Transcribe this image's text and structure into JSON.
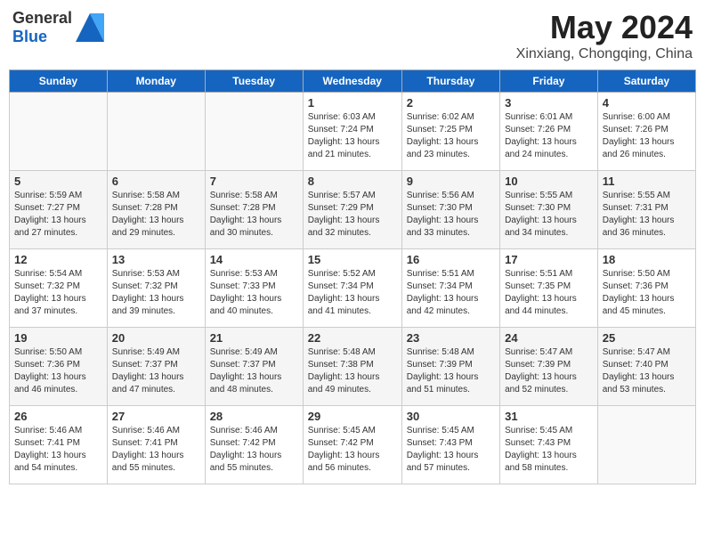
{
  "header": {
    "logo_general": "General",
    "logo_blue": "Blue",
    "title": "May 2024",
    "location": "Xinxiang, Chongqing, China"
  },
  "weekdays": [
    "Sunday",
    "Monday",
    "Tuesday",
    "Wednesday",
    "Thursday",
    "Friday",
    "Saturday"
  ],
  "weeks": [
    [
      {
        "day": "",
        "info": ""
      },
      {
        "day": "",
        "info": ""
      },
      {
        "day": "",
        "info": ""
      },
      {
        "day": "1",
        "info": "Sunrise: 6:03 AM\nSunset: 7:24 PM\nDaylight: 13 hours\nand 21 minutes."
      },
      {
        "day": "2",
        "info": "Sunrise: 6:02 AM\nSunset: 7:25 PM\nDaylight: 13 hours\nand 23 minutes."
      },
      {
        "day": "3",
        "info": "Sunrise: 6:01 AM\nSunset: 7:26 PM\nDaylight: 13 hours\nand 24 minutes."
      },
      {
        "day": "4",
        "info": "Sunrise: 6:00 AM\nSunset: 7:26 PM\nDaylight: 13 hours\nand 26 minutes."
      }
    ],
    [
      {
        "day": "5",
        "info": "Sunrise: 5:59 AM\nSunset: 7:27 PM\nDaylight: 13 hours\nand 27 minutes."
      },
      {
        "day": "6",
        "info": "Sunrise: 5:58 AM\nSunset: 7:28 PM\nDaylight: 13 hours\nand 29 minutes."
      },
      {
        "day": "7",
        "info": "Sunrise: 5:58 AM\nSunset: 7:28 PM\nDaylight: 13 hours\nand 30 minutes."
      },
      {
        "day": "8",
        "info": "Sunrise: 5:57 AM\nSunset: 7:29 PM\nDaylight: 13 hours\nand 32 minutes."
      },
      {
        "day": "9",
        "info": "Sunrise: 5:56 AM\nSunset: 7:30 PM\nDaylight: 13 hours\nand 33 minutes."
      },
      {
        "day": "10",
        "info": "Sunrise: 5:55 AM\nSunset: 7:30 PM\nDaylight: 13 hours\nand 34 minutes."
      },
      {
        "day": "11",
        "info": "Sunrise: 5:55 AM\nSunset: 7:31 PM\nDaylight: 13 hours\nand 36 minutes."
      }
    ],
    [
      {
        "day": "12",
        "info": "Sunrise: 5:54 AM\nSunset: 7:32 PM\nDaylight: 13 hours\nand 37 minutes."
      },
      {
        "day": "13",
        "info": "Sunrise: 5:53 AM\nSunset: 7:32 PM\nDaylight: 13 hours\nand 39 minutes."
      },
      {
        "day": "14",
        "info": "Sunrise: 5:53 AM\nSunset: 7:33 PM\nDaylight: 13 hours\nand 40 minutes."
      },
      {
        "day": "15",
        "info": "Sunrise: 5:52 AM\nSunset: 7:34 PM\nDaylight: 13 hours\nand 41 minutes."
      },
      {
        "day": "16",
        "info": "Sunrise: 5:51 AM\nSunset: 7:34 PM\nDaylight: 13 hours\nand 42 minutes."
      },
      {
        "day": "17",
        "info": "Sunrise: 5:51 AM\nSunset: 7:35 PM\nDaylight: 13 hours\nand 44 minutes."
      },
      {
        "day": "18",
        "info": "Sunrise: 5:50 AM\nSunset: 7:36 PM\nDaylight: 13 hours\nand 45 minutes."
      }
    ],
    [
      {
        "day": "19",
        "info": "Sunrise: 5:50 AM\nSunset: 7:36 PM\nDaylight: 13 hours\nand 46 minutes."
      },
      {
        "day": "20",
        "info": "Sunrise: 5:49 AM\nSunset: 7:37 PM\nDaylight: 13 hours\nand 47 minutes."
      },
      {
        "day": "21",
        "info": "Sunrise: 5:49 AM\nSunset: 7:37 PM\nDaylight: 13 hours\nand 48 minutes."
      },
      {
        "day": "22",
        "info": "Sunrise: 5:48 AM\nSunset: 7:38 PM\nDaylight: 13 hours\nand 49 minutes."
      },
      {
        "day": "23",
        "info": "Sunrise: 5:48 AM\nSunset: 7:39 PM\nDaylight: 13 hours\nand 51 minutes."
      },
      {
        "day": "24",
        "info": "Sunrise: 5:47 AM\nSunset: 7:39 PM\nDaylight: 13 hours\nand 52 minutes."
      },
      {
        "day": "25",
        "info": "Sunrise: 5:47 AM\nSunset: 7:40 PM\nDaylight: 13 hours\nand 53 minutes."
      }
    ],
    [
      {
        "day": "26",
        "info": "Sunrise: 5:46 AM\nSunset: 7:41 PM\nDaylight: 13 hours\nand 54 minutes."
      },
      {
        "day": "27",
        "info": "Sunrise: 5:46 AM\nSunset: 7:41 PM\nDaylight: 13 hours\nand 55 minutes."
      },
      {
        "day": "28",
        "info": "Sunrise: 5:46 AM\nSunset: 7:42 PM\nDaylight: 13 hours\nand 55 minutes."
      },
      {
        "day": "29",
        "info": "Sunrise: 5:45 AM\nSunset: 7:42 PM\nDaylight: 13 hours\nand 56 minutes."
      },
      {
        "day": "30",
        "info": "Sunrise: 5:45 AM\nSunset: 7:43 PM\nDaylight: 13 hours\nand 57 minutes."
      },
      {
        "day": "31",
        "info": "Sunrise: 5:45 AM\nSunset: 7:43 PM\nDaylight: 13 hours\nand 58 minutes."
      },
      {
        "day": "",
        "info": ""
      }
    ]
  ]
}
